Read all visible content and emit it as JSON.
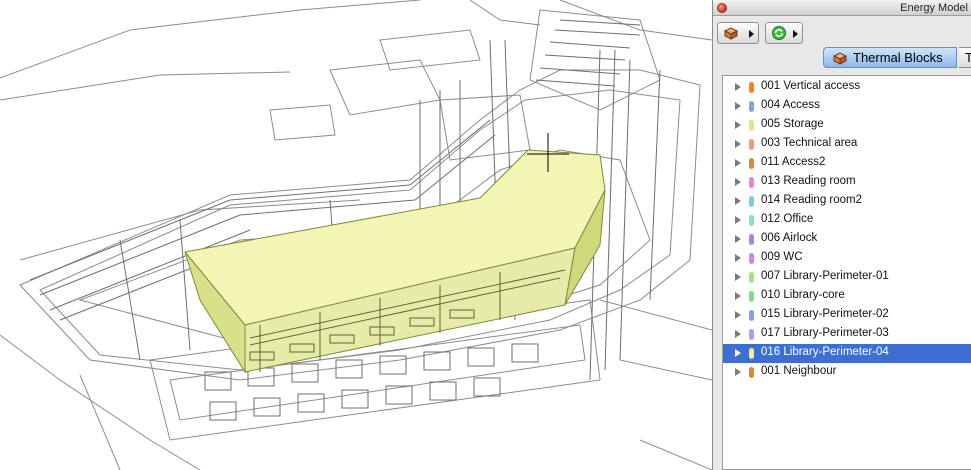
{
  "window": {
    "title": "Energy Model"
  },
  "toolbar": {
    "buttons": [
      {
        "icon": "thermal-block-icon"
      },
      {
        "icon": "refresh-icon"
      }
    ]
  },
  "tabs": {
    "active_label": "Thermal Blocks",
    "next_label_partial": "T"
  },
  "thermal_blocks": [
    {
      "label": "001 Vertical access",
      "color": "#e8852a",
      "selected": false
    },
    {
      "label": "004 Access",
      "color": "#7fa6d4",
      "selected": false
    },
    {
      "label": "005 Storage",
      "color": "#e6e08a",
      "selected": false
    },
    {
      "label": "003 Technical area",
      "color": "#e8a07a",
      "selected": false
    },
    {
      "label": "011 Access2",
      "color": "#e8852a",
      "selected": false
    },
    {
      "label": "013 Reading room",
      "color": "#df86d9",
      "selected": false
    },
    {
      "label": "014 Reading room2",
      "color": "#86c6e6",
      "selected": false
    },
    {
      "label": "012 Office",
      "color": "#86e0c8",
      "selected": false
    },
    {
      "label": "006 Airlock",
      "color": "#9c8ae0",
      "selected": false
    },
    {
      "label": "009 WC",
      "color": "#c48ae6",
      "selected": false
    },
    {
      "label": "007 Library-Perimeter-01",
      "color": "#a9de8c",
      "selected": false
    },
    {
      "label": "010 Library-core",
      "color": "#86d98a",
      "selected": false
    },
    {
      "label": "015 Library-Perimeter-02",
      "color": "#8a9ee6",
      "selected": false
    },
    {
      "label": "017 Library-Perimeter-03",
      "color": "#b59ae0",
      "selected": false
    },
    {
      "label": "016 Library-Perimeter-04",
      "color": "#eef08e",
      "selected": true
    },
    {
      "label": "001 Neighbour",
      "color": "#e8852a",
      "selected": false
    }
  ]
}
